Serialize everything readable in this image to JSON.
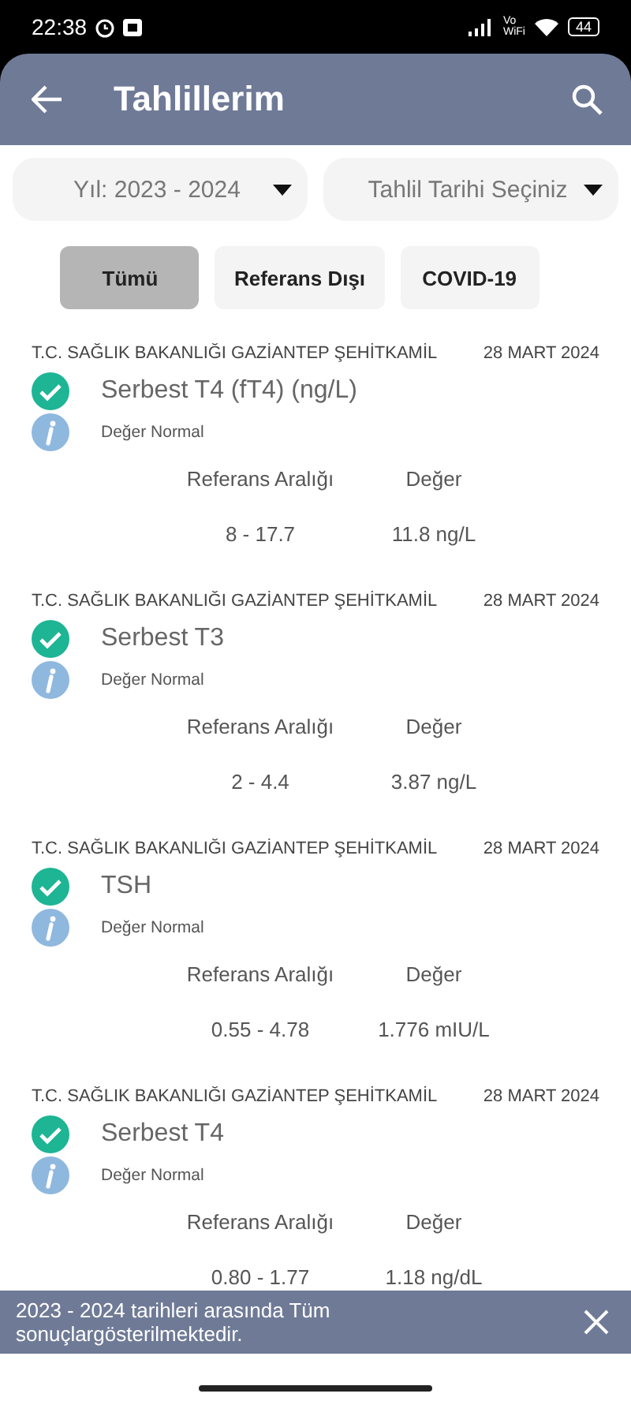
{
  "status_bar": {
    "time": "22:38",
    "network_top": "Vo",
    "network_bottom": "WiFi",
    "battery": "44"
  },
  "header": {
    "title": "Tahlillerim"
  },
  "filters": [
    {
      "label": "Yıl: 2023 - 2024"
    },
    {
      "label": "Tahlil Tarihi Seçiniz"
    }
  ],
  "chips": [
    {
      "label": "Tümü",
      "selected": true
    },
    {
      "label": "Referans Dışı",
      "selected": false
    },
    {
      "label": "COVID-19",
      "selected": false
    }
  ],
  "results": [
    {
      "institution": "T.C. SAĞLIK BAKANLIĞI GAZİANTEP ŞEHİTKAMİL",
      "date": "28 MART 2024",
      "test": "Serbest T4 (fT4) (ng/L)",
      "kind": "normal",
      "note": "Değer Normal",
      "range_label": "Referans Aralığı",
      "value_label": "Değer",
      "range": "8 - 17.7",
      "value": "11.8 ng/L"
    },
    {
      "institution": "T.C. SAĞLIK BAKANLIĞI GAZİANTEP ŞEHİTKAMİL",
      "date": "28 MART 2024",
      "test": "Serbest T3",
      "kind": "normal",
      "note": "Değer Normal",
      "range_label": "Referans Aralığı",
      "value_label": "Değer",
      "range": "2 - 4.4",
      "value": "3.87 ng/L"
    },
    {
      "institution": "T.C. SAĞLIK BAKANLIĞI GAZİANTEP ŞEHİTKAMİL",
      "date": "28 MART 2024",
      "test": "TSH",
      "kind": "normal",
      "note": "Değer Normal",
      "range_label": "Referans Aralığı",
      "value_label": "Değer",
      "range": "0.55 - 4.78",
      "value": "1.776 mIU/L"
    },
    {
      "institution": "T.C. SAĞLIK BAKANLIĞI GAZİANTEP ŞEHİTKAMİL",
      "date": "28 MART 2024",
      "test": "Serbest T4",
      "kind": "normal",
      "note": "Değer Normal",
      "range_label": "Referans Aralığı",
      "value_label": "Değer",
      "range": "0.80 - 1.77",
      "value": "1.18 ng/dL"
    }
  ],
  "snackbar": {
    "message": "2023 - 2024 tarihleri arasında Tüm sonuçlargösterilmektedir."
  }
}
